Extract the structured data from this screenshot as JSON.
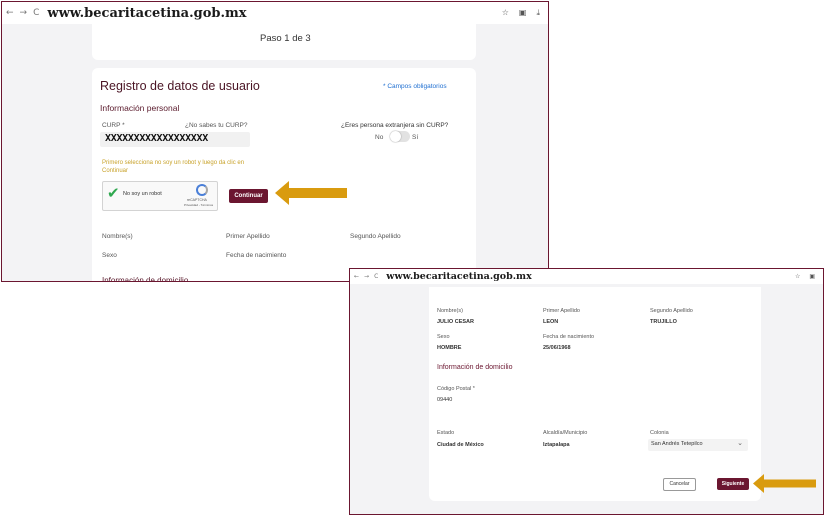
{
  "browser": {
    "url": "www.becaritacetina.gob.mx",
    "back_icon": "←",
    "forward_icon": "→",
    "reload_icon": "C",
    "star_icon": "☆",
    "ext_icon": "▣",
    "download_icon": "⤓"
  },
  "step": {
    "label": "Paso 1 de 3"
  },
  "form": {
    "title": "Registro de datos de usuario",
    "required_note": "* Campos obligatorios",
    "personal_section": "Información personal",
    "curp_label": "CURP *",
    "curp_help": "¿No sabes tu CURP?",
    "curp_value": "XXXXXXXXXXXXXXXXXX",
    "foreign_label": "¿Eres persona extranjera sin CURP?",
    "toggle_no": "No",
    "toggle_si": "Sí",
    "robot_hint": "Primero selecciona no soy un robot y luego da clic en Continuar",
    "captcha_label": "No soy un robot",
    "captcha_brand": "reCAPTCHA",
    "captcha_terms": "Privacidad - Términos",
    "continue_button": "Continuar",
    "nombres_label": "Nombre(s)",
    "primer_apellido_label": "Primer Apellido",
    "segundo_apellido_label": "Segundo Apellido",
    "sexo_label": "Sexo",
    "fecha_label": "Fecha de nacimiento",
    "domicilio_section": "Información de domicilio"
  },
  "form2": {
    "nombres_value": "JULIO CESAR",
    "primer_apellido_value": "LEON",
    "segundo_apellido_value": "TRUJILLO",
    "sexo_value": "HOMBRE",
    "fecha_value": "25/06/1968",
    "cp_label": "Código Postal *",
    "cp_value": "09440",
    "estado_label": "Estado",
    "estado_value": "Ciudad de México",
    "alcaldia_label": "Alcaldía/Municipio",
    "alcaldia_value": "Iztapalapa",
    "colonia_label": "Colonia",
    "colonia_value": "San Andrés Tetepilco",
    "cancel_button": "Cancelar",
    "next_button": "Siguiente"
  },
  "colors": {
    "brand": "#6b1630",
    "accent_arrow": "#d99b0f",
    "link": "#1f6fd1",
    "hint": "#c8a22a"
  }
}
